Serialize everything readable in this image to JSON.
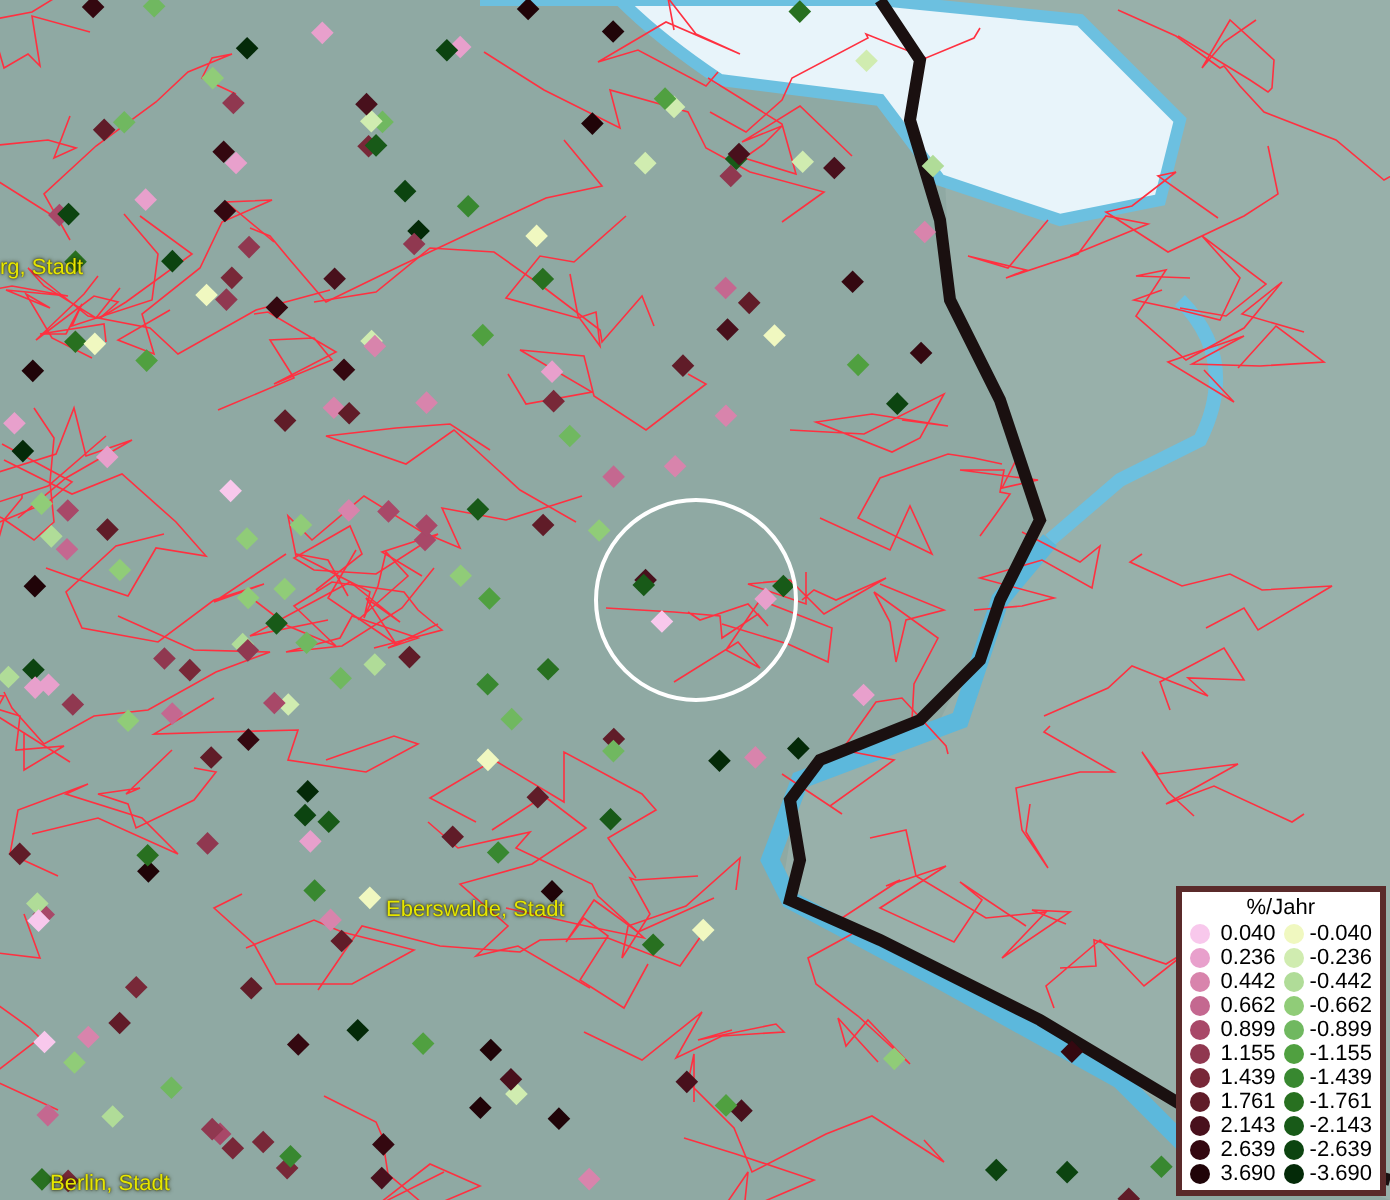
{
  "map": {
    "place_labels": [
      {
        "text": "rg, Stadt"
      },
      {
        "text": "Eberswalde, Stadt"
      },
      {
        "text": "Berlin, Stadt"
      }
    ]
  },
  "legend": {
    "title": "%/Jahr",
    "positive": [
      {
        "value": "0.040",
        "color": "#f8c8ec"
      },
      {
        "value": "0.236",
        "color": "#e8a0cc"
      },
      {
        "value": "0.442",
        "color": "#d884ac"
      },
      {
        "value": "0.662",
        "color": "#c46890"
      },
      {
        "value": "0.899",
        "color": "#a84868"
      },
      {
        "value": "1.155",
        "color": "#903850"
      },
      {
        "value": "1.439",
        "color": "#782838"
      },
      {
        "value": "1.761",
        "color": "#601c28"
      },
      {
        "value": "2.143",
        "color": "#48101c"
      },
      {
        "value": "2.639",
        "color": "#340810"
      },
      {
        "value": "3.690",
        "color": "#200408"
      }
    ],
    "negative": [
      {
        "value": "-0.040",
        "color": "#f0f8c0"
      },
      {
        "value": "-0.236",
        "color": "#d0ecb0"
      },
      {
        "value": "-0.442",
        "color": "#b0dc98"
      },
      {
        "value": "-0.662",
        "color": "#90cc78"
      },
      {
        "value": "-0.899",
        "color": "#70b860"
      },
      {
        "value": "-1.155",
        "color": "#50a040"
      },
      {
        "value": "-1.439",
        "color": "#388830"
      },
      {
        "value": "-1.761",
        "color": "#287020"
      },
      {
        "value": "-2.143",
        "color": "#185a18"
      },
      {
        "value": "-2.639",
        "color": "#0c4410"
      },
      {
        "value": "-3.690",
        "color": "#042a08"
      }
    ]
  }
}
